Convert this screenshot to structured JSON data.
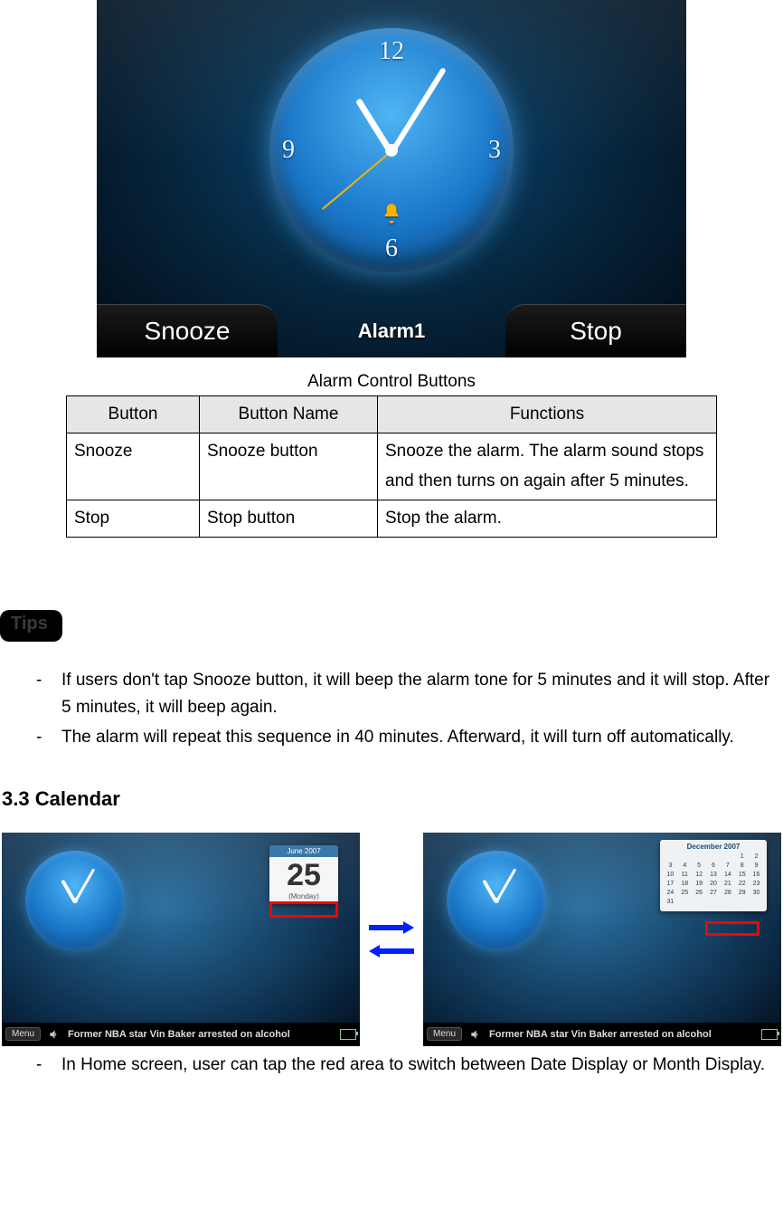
{
  "alarm_screenshot": {
    "clock_numbers": {
      "n12": "12",
      "n3": "3",
      "n6": "6",
      "n9": "9"
    },
    "snooze_label": "Snooze",
    "stop_label": "Stop",
    "alarm_name": "Alarm1"
  },
  "table": {
    "caption": "Alarm Control Buttons",
    "headers": {
      "c1": "Button",
      "c2": "Button Name",
      "c3": "Functions"
    },
    "rows": [
      {
        "c1": "Snooze",
        "c2": "Snooze button",
        "c3": "Snooze the alarm. The alarm sound stops and then turns on again after 5 minutes."
      },
      {
        "c1": "Stop",
        "c2": "Stop button",
        "c3": "Stop the alarm."
      }
    ]
  },
  "tips": {
    "badge": "Tips",
    "items": [
      "If users don't tap Snooze button, it will beep the alarm tone for 5 minutes and it will stop. After 5 minutes, it will beep again.",
      "The alarm will repeat this sequence in 40 minutes. Afterward, it will turn off automatically."
    ]
  },
  "section_heading": "3.3 Calendar",
  "calendar": {
    "left": {
      "month_label": "June 2007",
      "day_number": "25",
      "weekday": "(Monday)",
      "menu": "Menu",
      "ticker": "Former NBA star Vin Baker arrested on alcohol"
    },
    "right": {
      "month_label": "December 2007",
      "menu": "Menu",
      "ticker": "Former NBA star Vin Baker arrested on alcohol"
    },
    "note": "In Home screen, user can tap the red area to switch between Date Display or Month Display."
  }
}
